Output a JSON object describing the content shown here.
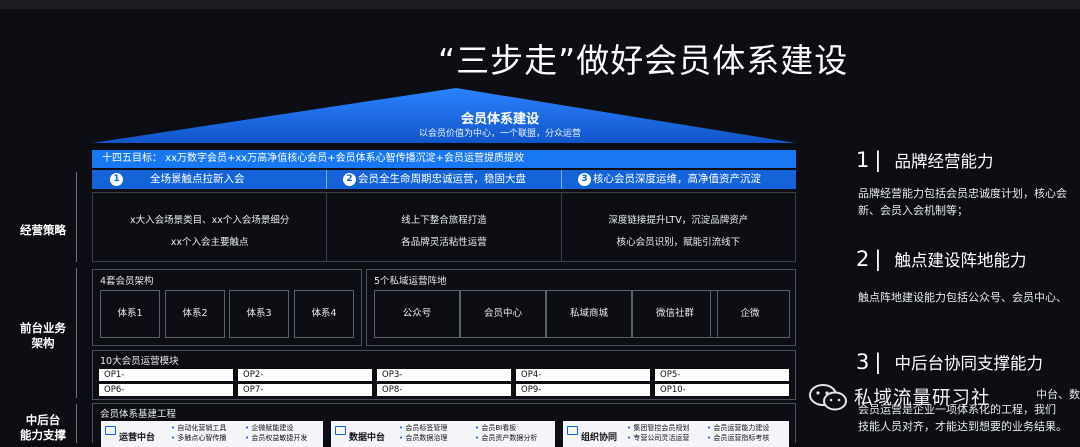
{
  "title": "“三步走”做好会员体系建设",
  "roof": {
    "title": "会员体系建设",
    "subtitle": "以会员价值为中心，一个联盟，分众运营"
  },
  "goal": "十四五目标： xx万数字会员+xx万高净值核心会员+会员体系心智传播沉淀+会员运营提质提效",
  "steps": [
    {
      "num": "1",
      "label": "全场景触点拉新入会"
    },
    {
      "num": "2",
      "label": "会员全生命周期忠诚运营，稳固大盘"
    },
    {
      "num": "3",
      "label": "核心会员深度运维，高净值资产沉淀"
    }
  ],
  "strategy": [
    {
      "lines": [
        "x大入会场景类目、xx个入会场景细分",
        "xx个入会主要触点"
      ]
    },
    {
      "lines": [
        "线上下整合旅程打造",
        "各品牌灵活粘性运营"
      ]
    },
    {
      "lines": [
        "深度链接提升LTV，沉淀品牌资产",
        "核心会员识别，赋能引流线下"
      ]
    }
  ],
  "row_labels": {
    "strategy": "经营策略",
    "front_line1": "前台业务",
    "front_line2": "架构",
    "middle_line1": "中后台",
    "middle_line2": "能力支撑"
  },
  "arch": {
    "title": "4套会员架构",
    "items": [
      "体系1",
      "体系2",
      "体系3",
      "体系4"
    ]
  },
  "private": {
    "title": "5个私域运营阵地",
    "items": [
      "公众号",
      "会员中心",
      "私域商城",
      "微信社群",
      "企微"
    ]
  },
  "ops": {
    "title": "10大会员运营模块",
    "items": [
      "OP1-",
      "OP2-",
      "OP3-",
      "OP4-",
      "OP5-",
      "OP6-",
      "OP7-",
      "OP8-",
      "OP9-",
      "OP10-"
    ]
  },
  "base": {
    "title": "会员体系基建工程",
    "tiles": [
      {
        "name": "运营中台",
        "col1": [
          "自动化营销工具",
          "多触点心智传播"
        ],
        "col2": [
          "企微赋能建设",
          "会员权益敏捷开发"
        ]
      },
      {
        "name": "数据中台",
        "col1": [
          "会员标签管理",
          "会员数据治理"
        ],
        "col2": [
          "会员BI看板",
          "会员资产数据分析"
        ]
      },
      {
        "name": "组织协同",
        "col1": [
          "集团管控会员规划",
          "专营公司灵活运营"
        ],
        "col2": [
          "会员运营能力建设",
          "会员运营指标考核"
        ]
      }
    ]
  },
  "right": [
    {
      "num": "1",
      "title": "品牌经营能力",
      "desc": [
        "品牌经营能力包括会员忠诚度计划，核心会",
        "新、会员入会机制等；"
      ]
    },
    {
      "num": "2",
      "title": "触点建设阵地能力",
      "desc": [
        "触点阵地建设能力包括公众号、会员中心、"
      ]
    },
    {
      "num": "3",
      "title": "中后台协同支撑能力",
      "desc": [
        "会员运营是企业一项体系化的工程，我们",
        "技能人员对齐，才能达到想要的业务结果。"
      ]
    }
  ],
  "overlap_text": "中台、数",
  "watermark": "私域流量研习社",
  "colors": {
    "accent": "#1877f2",
    "background": "#0c0e13"
  }
}
